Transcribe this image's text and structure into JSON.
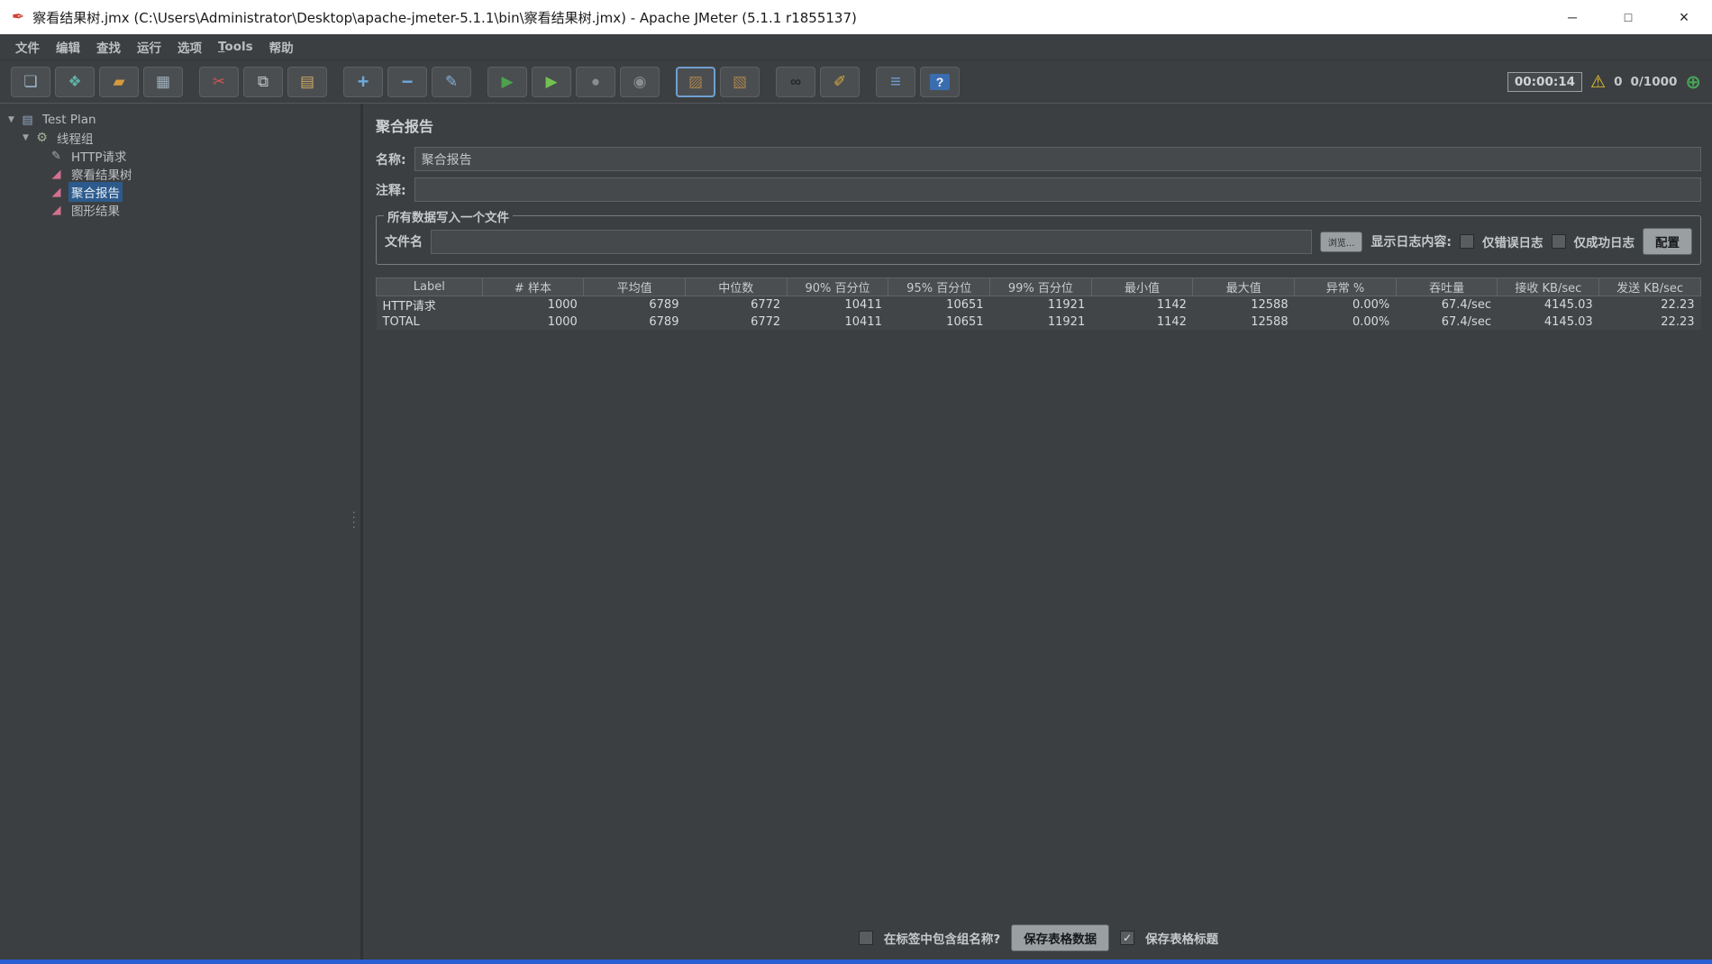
{
  "window": {
    "title": "察看结果树.jmx (C:\\Users\\Administrator\\Desktop\\apache-jmeter-5.1.1\\bin\\察看结果树.jmx) - Apache JMeter (5.1.1 r1855137)"
  },
  "menubar": {
    "items": [
      "文件",
      "编辑",
      "查找",
      "运行",
      "选项",
      "Tools",
      "帮助"
    ]
  },
  "toolbar": {
    "timer": "00:00:14",
    "warning_count": "0",
    "threads": "0/1000"
  },
  "tree": {
    "items": [
      {
        "label": "Test Plan"
      },
      {
        "label": "线程组"
      },
      {
        "label": "HTTP请求"
      },
      {
        "label": "察看结果树"
      },
      {
        "label": "聚合报告"
      },
      {
        "label": "图形结果"
      }
    ]
  },
  "main": {
    "title": "聚合报告",
    "name_label": "名称:",
    "name_value": "聚合报告",
    "comment_label": "注释:",
    "comment_value": "",
    "file_group": {
      "title": "所有数据写入一个文件",
      "filename_label": "文件名",
      "filename_value": "",
      "browse_button": "浏览...",
      "log_display_label": "显示日志内容:",
      "errors_only_label": "仅错误日志",
      "success_only_label": "仅成功日志",
      "configure_button": "配置"
    },
    "table": {
      "columns": [
        "Label",
        "# 样本",
        "平均值",
        "中位数",
        "90% 百分位",
        "95% 百分位",
        "99% 百分位",
        "最小值",
        "最大值",
        "异常 %",
        "吞吐量",
        "接收 KB/sec",
        "发送 KB/sec"
      ],
      "rows": [
        [
          "HTTP请求",
          "1000",
          "6789",
          "6772",
          "10411",
          "10651",
          "11921",
          "1142",
          "12588",
          "0.00%",
          "67.4/sec",
          "4145.03",
          "22.23"
        ],
        [
          "TOTAL",
          "1000",
          "6789",
          "6772",
          "10411",
          "10651",
          "11921",
          "1142",
          "12588",
          "0.00%",
          "67.4/sec",
          "4145.03",
          "22.23"
        ]
      ]
    },
    "footer": {
      "include_group_label": "在标签中包含组名称?",
      "save_table_button": "保存表格数据",
      "save_header_label": "保存表格标题"
    }
  },
  "icons": {
    "app": "✒",
    "minimize": "─",
    "maximize": "□",
    "close": "×",
    "new_file": "❏",
    "templates": "❖",
    "open_folder": "▰",
    "save": "▦",
    "cut": "✂",
    "copy": "⧉",
    "paste": "▤",
    "expand_all": "+",
    "collapse_all": "−",
    "toggle": "✎",
    "start": "▶",
    "start_no_pauses": "▶",
    "stop": "●",
    "shutdown": "◉",
    "clear": "▨",
    "clear_all": "▧",
    "search": "∞",
    "search_reset": "✐",
    "function_helper": "≡",
    "help": "?",
    "warning": "⚠",
    "remote_start": "⊕",
    "expander_open": "▼",
    "test_plan": "▤",
    "thread_group": "⚙",
    "sampler": "✎",
    "listener": "◢",
    "check": "✓",
    "grip": "····"
  },
  "colors": {
    "selection": "#2c5a8c",
    "accent_bottom": "#2a5fd4",
    "warning": "#e7c52c",
    "start_green": "#4ca24c"
  }
}
